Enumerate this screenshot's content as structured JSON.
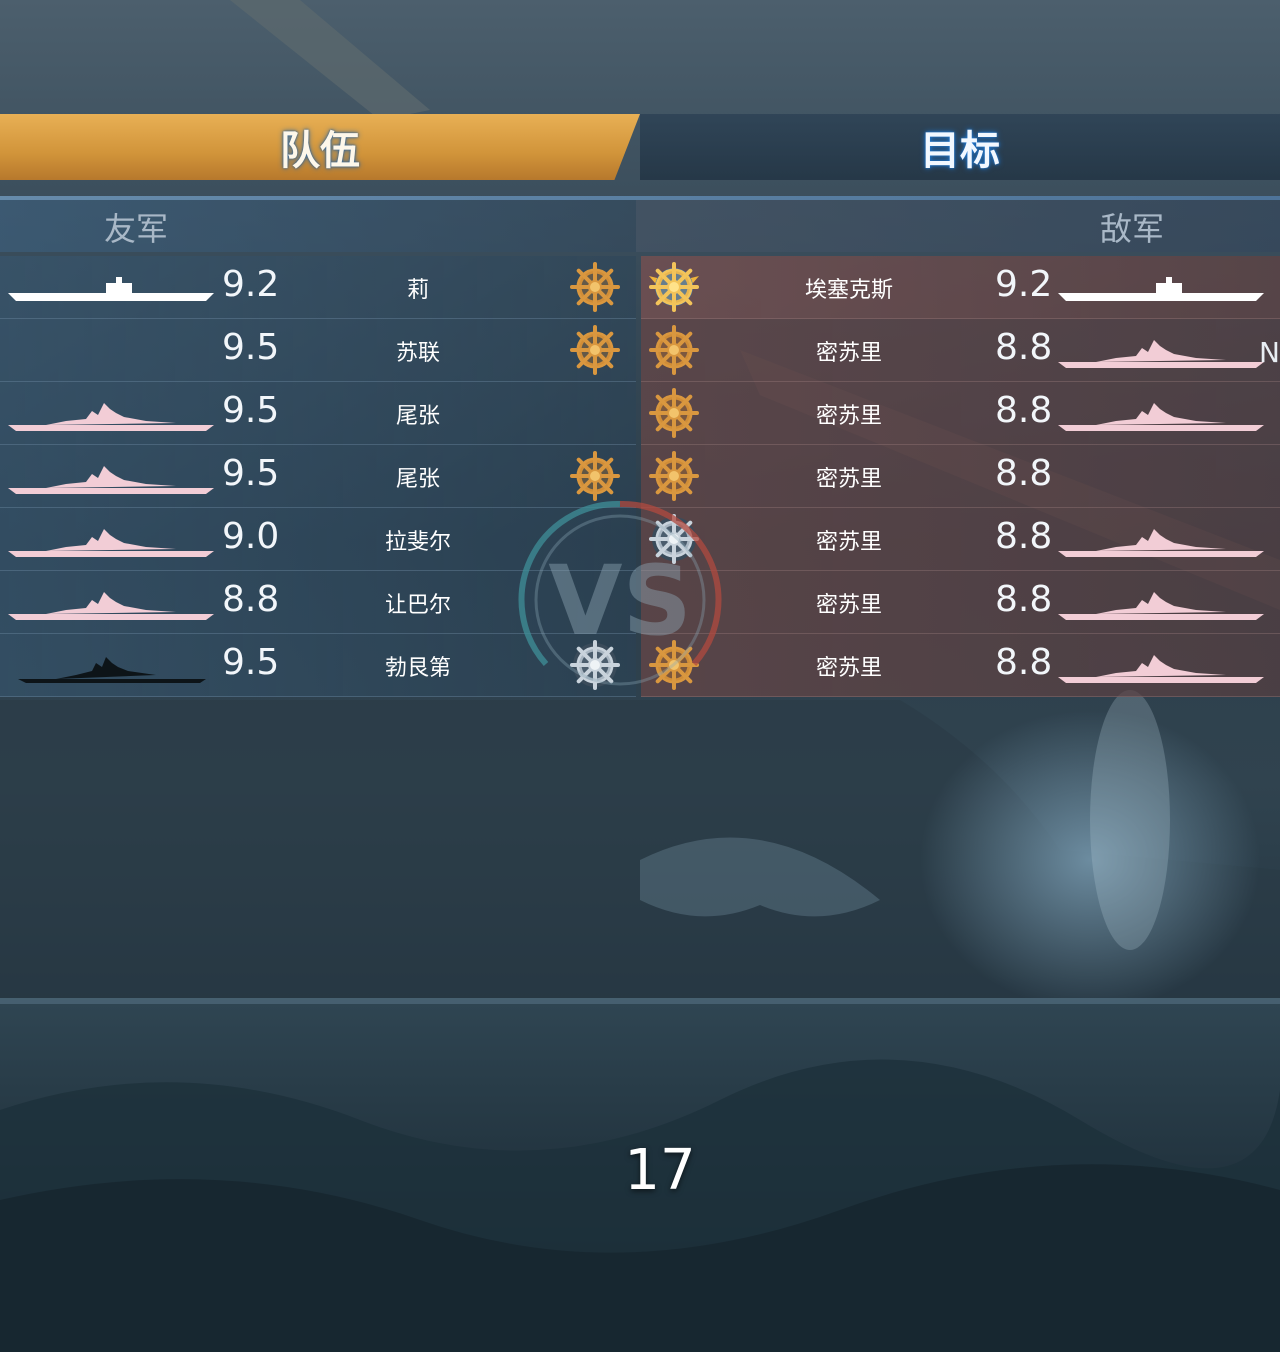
{
  "tabs": {
    "team_label": "队伍",
    "target_label": "目标"
  },
  "headers": {
    "friendly": "友军",
    "enemy": "敌军"
  },
  "friendly": [
    {
      "rating": "9.2",
      "name": "莉",
      "badge": "gold-wheel",
      "silhouette": "carrier"
    },
    {
      "rating": "9.5",
      "name": "苏联",
      "badge": "gold-wheel",
      "silhouette": "none"
    },
    {
      "rating": "9.5",
      "name": "尾张",
      "badge": "none",
      "silhouette": "battleship"
    },
    {
      "rating": "9.5",
      "name": "尾张",
      "badge": "gold-wheel",
      "silhouette": "battleship"
    },
    {
      "rating": "9.0",
      "name": "拉斐尔",
      "badge": "none",
      "silhouette": "battleship"
    },
    {
      "rating": "8.8",
      "name": "让巴尔",
      "badge": "none",
      "silhouette": "battleship"
    },
    {
      "rating": "9.5",
      "name": "勃艮第",
      "badge": "silver-wheel",
      "silhouette": "dark-battleship"
    }
  ],
  "enemy": [
    {
      "rating": "9.2",
      "name": "埃塞克斯",
      "badge": "winged-gold-wheel",
      "silhouette": "carrier"
    },
    {
      "rating": "8.8",
      "name": "密苏里",
      "badge": "gold-wheel",
      "silhouette": "battleship"
    },
    {
      "rating": "8.8",
      "name": "密苏里",
      "badge": "gold-wheel",
      "silhouette": "battleship"
    },
    {
      "rating": "8.8",
      "name": "密苏里",
      "badge": "gold-wheel",
      "silhouette": "none"
    },
    {
      "rating": "8.8",
      "name": "密苏里",
      "badge": "silver-wheel",
      "silhouette": "battleship"
    },
    {
      "rating": "8.8",
      "name": "密苏里",
      "badge": "none",
      "silhouette": "battleship"
    },
    {
      "rating": "8.8",
      "name": "密苏里",
      "badge": "gold-wheel",
      "silhouette": "battleship"
    }
  ],
  "edge_letter": "N",
  "vs_text": "VS",
  "countdown": "17",
  "colors": {
    "gold_tab": "#d99b3f",
    "friendly_row": "#375873",
    "enemy_row": "#684646",
    "silhouette_pink": "#f2cdd6",
    "silhouette_white": "#ffffff"
  }
}
